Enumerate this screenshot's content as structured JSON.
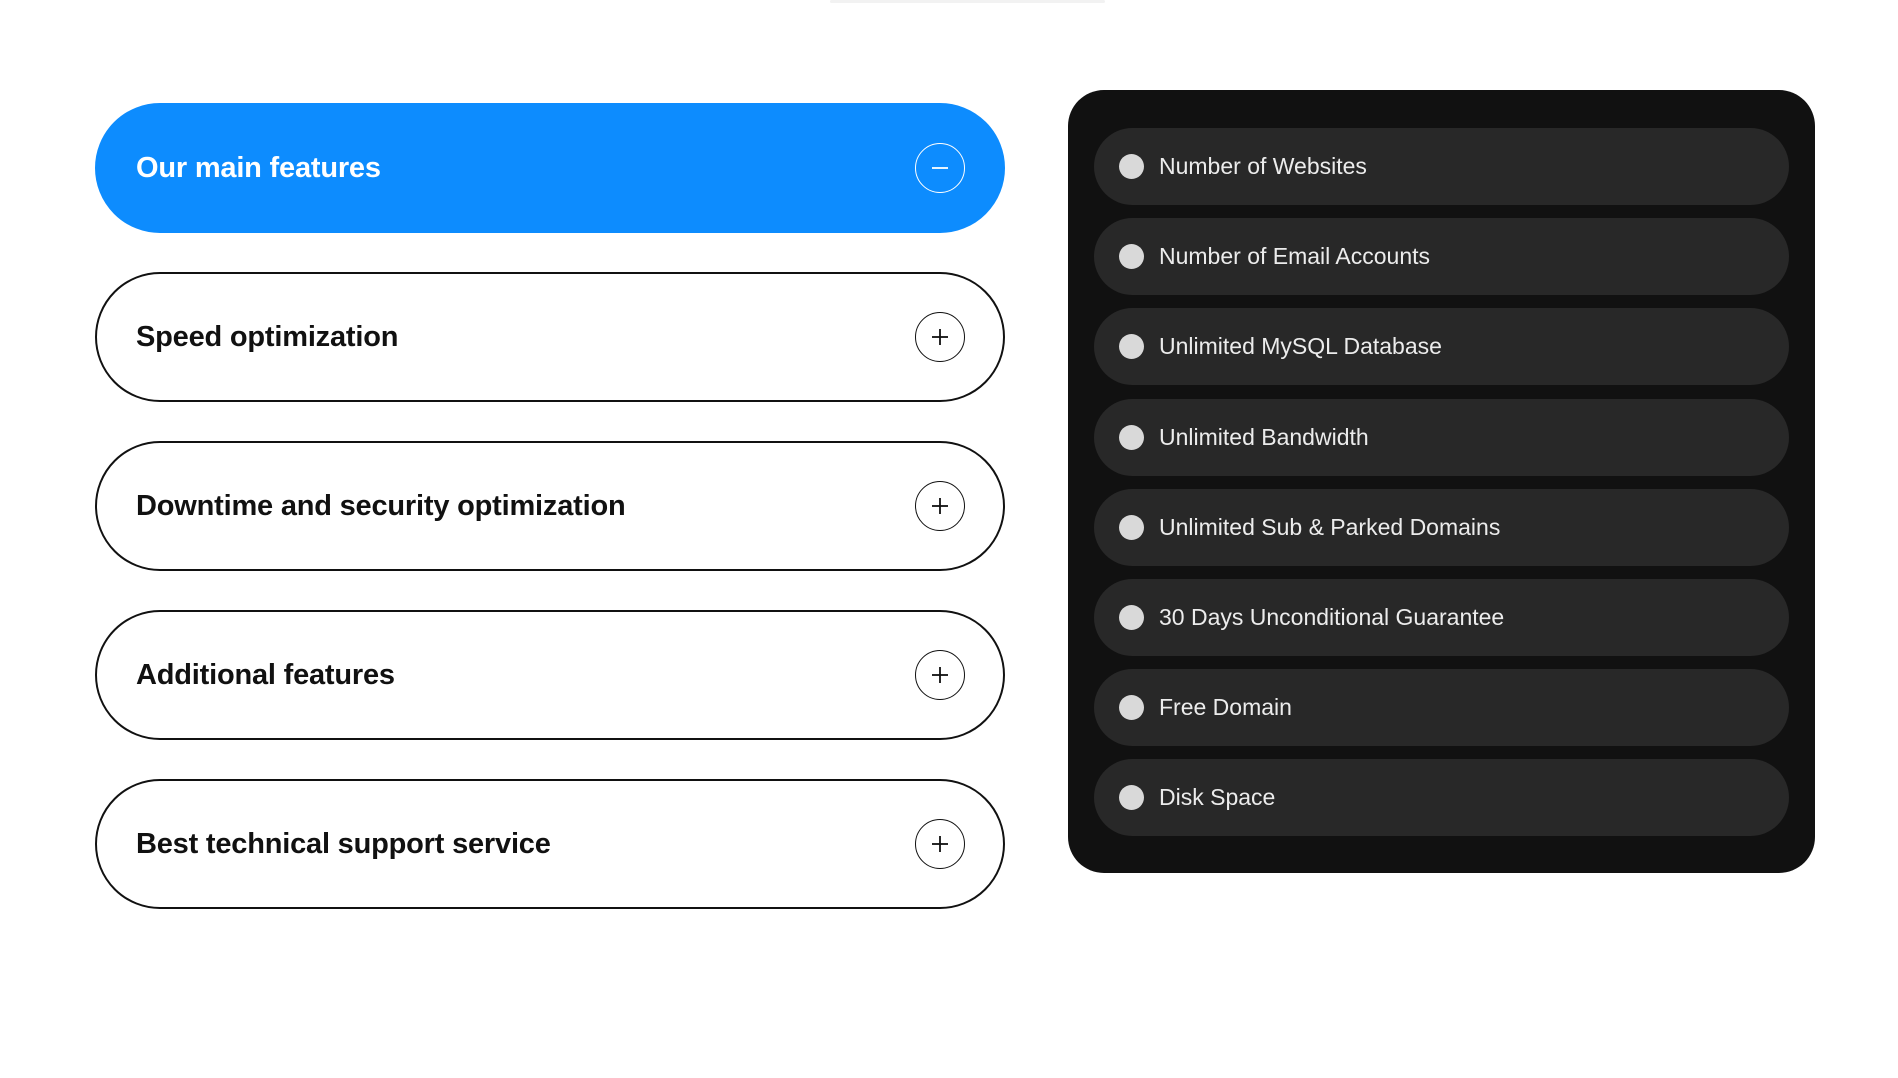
{
  "colors": {
    "accent": "#0d8cfe",
    "panel_bg": "#111111",
    "row_bg": "#282828",
    "bullet": "#d9d9d9",
    "text_dark": "#111111",
    "text_light": "#ececec"
  },
  "accordion": {
    "items": [
      {
        "title": "Our main features",
        "expanded": true,
        "icon": "minus-icon"
      },
      {
        "title": "Speed optimization",
        "expanded": false,
        "icon": "plus-icon"
      },
      {
        "title": "Downtime and security optimization",
        "expanded": false,
        "icon": "plus-icon"
      },
      {
        "title": "Additional features",
        "expanded": false,
        "icon": "plus-icon"
      },
      {
        "title": "Best technical support service",
        "expanded": false,
        "icon": "plus-icon"
      }
    ]
  },
  "features": {
    "items": [
      {
        "label": "Number of Websites"
      },
      {
        "label": "Number of Email Accounts"
      },
      {
        "label": "Unlimited MySQL Database"
      },
      {
        "label": "Unlimited Bandwidth"
      },
      {
        "label": "Unlimited Sub & Parked Domains"
      },
      {
        "label": "30 Days Unconditional Guarantee"
      },
      {
        "label": "Free Domain"
      },
      {
        "label": "Disk Space"
      }
    ]
  }
}
